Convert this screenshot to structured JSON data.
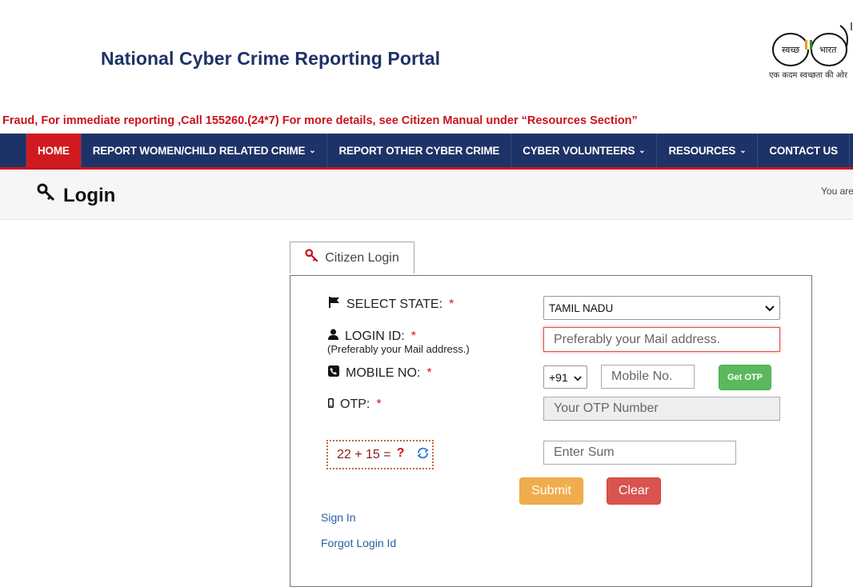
{
  "header": {
    "site_title": "National Cyber Crime Reporting Portal",
    "swachh_logo_left": "स्वच्छ",
    "swachh_logo_right": "भारत",
    "swachh_tagline": "एक कदम स्वच्छता की ओर"
  },
  "ticker": {
    "text": "Fraud, For immediate reporting ,Call 155260.(24*7) For more details, see Citizen Manual under “Resources Section”"
  },
  "nav": {
    "items": [
      {
        "label": "HOME",
        "dropdown": false,
        "active": true
      },
      {
        "label": "REPORT WOMEN/CHILD RELATED CRIME",
        "dropdown": true
      },
      {
        "label": "REPORT OTHER CYBER CRIME",
        "dropdown": false
      },
      {
        "label": "CYBER VOLUNTEERS",
        "dropdown": true
      },
      {
        "label": "RESOURCES",
        "dropdown": true
      },
      {
        "label": "CONTACT US",
        "dropdown": false
      }
    ],
    "chevron": "⌄"
  },
  "page": {
    "title": "Login",
    "breadcrumb_prefix": "You are"
  },
  "tab": {
    "label": "Citizen Login"
  },
  "form": {
    "required_mark": "*",
    "state": {
      "label": "SELECT STATE:",
      "value": "TAMIL NADU"
    },
    "login_id": {
      "label": "LOGIN ID:",
      "sublabel": "(Preferably your Mail address.)",
      "placeholder": "Preferably your Mail address."
    },
    "mobile": {
      "label": "MOBILE NO:",
      "country_code": "+91",
      "placeholder": "Mobile No.",
      "otp_button": "Get OTP"
    },
    "otp": {
      "label": "OTP:",
      "placeholder": "Your OTP Number"
    },
    "captcha": {
      "question": "22 + 15 =",
      "mark": "?",
      "sum_placeholder": "Enter Sum"
    },
    "submit_label": "Submit",
    "clear_label": "Clear",
    "sign_in_link": "Sign In",
    "forgot_link": "Forgot Login Id"
  },
  "colors": {
    "navy": "#1d3266",
    "red": "#d11a1f",
    "submit": "#f0ad4e",
    "clear": "#d9534f",
    "otp_button": "#5cb85c"
  }
}
